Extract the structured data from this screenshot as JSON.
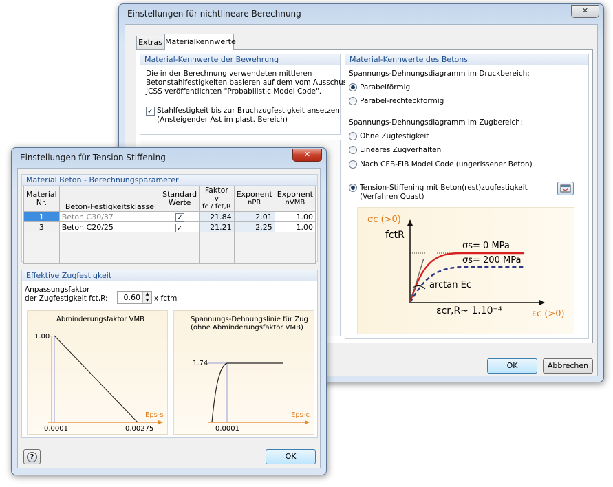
{
  "main_dialog": {
    "title": "Einstellungen für nichtlineare Berechnung",
    "close_label": "✕",
    "tabs": [
      {
        "label": "Extras"
      },
      {
        "label": "Materialkennwerte"
      }
    ],
    "reinforcement": {
      "header": "Material-Kennwerte der Bewehrung",
      "desc": [
        "Die in der Berechnung verwendeten mittleren",
        "Betonstahlfestigkeiten basieren auf dem vom Ausschuss",
        "JCSS veröffentlichten \"Probabilistic Model Code\"."
      ],
      "checkbox_line1": "Stahlfestigkeit bis zur Bruchzugfestigkeit ansetzen",
      "checkbox_line2": "(Ansteigender Ast im plast. Bereich)"
    },
    "concrete": {
      "header": "Material-Kennwerte des Betons",
      "compression_label": "Spannungs-Dehnungsdiagramm im Druckbereich:",
      "compression_options": [
        "Parabelförmig",
        "Parabel-rechteckförmig"
      ],
      "tension_label": "Spannungs-Dehnungsdiagramm im Zugbereich:",
      "tension_options": [
        "Ohne Zugfestigkeit",
        "Lineares Zugverhalten",
        "Nach CEB-FIB Model Code (ungerissener Beton)"
      ],
      "tension_stiffening_line1": "Tension-Stiffening mit Beton(rest)zugfestigkeit",
      "tension_stiffening_line2": "(Verfahren Quast)",
      "diagram": {
        "sigma_c": "σc (>0)",
        "fctR": "fctR",
        "sigma_s0": "σs= 0 MPa",
        "sigma_s200": "σs= 200 MPa",
        "arctan": "arctan Ec",
        "eps_cr": "εcr,R~ 1.10⁻⁴",
        "eps_c": "εc (>0)"
      }
    },
    "ok_label": "OK",
    "cancel_label": "Abbrechen"
  },
  "ts_dialog": {
    "title": "Einstellungen für Tension Stiffening",
    "close_label": "✕",
    "material_header": "Material Beton - Berechnungsparameter",
    "columns": {
      "nr": [
        "Material",
        "Nr."
      ],
      "class": "Beton-Festigkeitsklasse",
      "standard": [
        "Standard",
        "Werte"
      ],
      "factor": [
        "Faktor v",
        "fc / fct,R"
      ],
      "exp_pr": [
        "Exponent",
        "nPR"
      ],
      "exp_vmb": [
        "Exponent",
        "nVMB"
      ]
    },
    "rows": [
      {
        "nr": "1",
        "class": "Beton C30/37",
        "factor": "21.84",
        "exp_pr": "2.01",
        "exp_vmb": "1.00"
      },
      {
        "nr": "3",
        "class": "Beton C20/25",
        "factor": "21.21",
        "exp_pr": "2.25",
        "exp_vmb": "1.00"
      }
    ],
    "eff_header": "Effektive Zugfestigkeit",
    "factor_label1": "Anpassungsfaktor",
    "factor_label2": "der Zugfestigkeit fct,R:",
    "factor_value": "0.60",
    "factor_unit": "x fctm",
    "chart1": {
      "title": "Abminderungsfaktor VMB",
      "y_label": "1.00",
      "x0": "0.0001",
      "x1": "0.00275",
      "axis": "Eps-s"
    },
    "chart2": {
      "title1": "Spannungs-Dehnungslinie für Zug",
      "title2": "(ohne Abminderungsfaktor VMB)",
      "y_label": "1.74",
      "x0": "0.0001",
      "axis": "Eps-c"
    },
    "ok_label": "OK",
    "help_icon": "help-icon"
  }
}
